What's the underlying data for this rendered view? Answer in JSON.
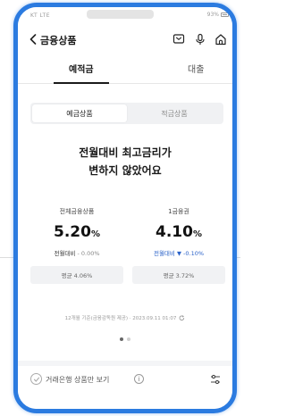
{
  "status_bar": {
    "left": "KT LTE",
    "right": "93%"
  },
  "header": {
    "title": "금융상품"
  },
  "tabs": [
    {
      "label": "예적금",
      "active": true
    },
    {
      "label": "대출",
      "active": false
    }
  ],
  "segment": [
    {
      "label": "예금상품",
      "active": true
    },
    {
      "label": "적금상품",
      "active": false
    }
  ],
  "headline": {
    "line1": "전월대비 최고금리가",
    "line2": "변하지 않았어요"
  },
  "stats": [
    {
      "label": "전체금융상품",
      "rate": "5.20",
      "unit": "%",
      "change_label": "전월대비",
      "change_value": "- 0.00%",
      "avg": "평균 4.06%"
    },
    {
      "label": "1금융권",
      "rate": "4.10",
      "unit": "%",
      "change_label": "전월대비",
      "change_value": "▼ -0.10%",
      "avg": "평균 3.72%"
    }
  ],
  "basis": {
    "text": "12개월 기준(금융감독원 제공) · 2023.09.11 01:07"
  },
  "pagination": {
    "current": 1,
    "total": 2
  },
  "filter": {
    "label": "거래은행 상품만 보기"
  },
  "colors": {
    "accent_blue": "#2a62c9",
    "frame_blue": "#2b7be0"
  },
  "icons": [
    "back-arrow-icon",
    "chat-icon",
    "microphone-icon",
    "home-icon",
    "refresh-icon",
    "check-icon",
    "info-icon",
    "filter-icon"
  ]
}
